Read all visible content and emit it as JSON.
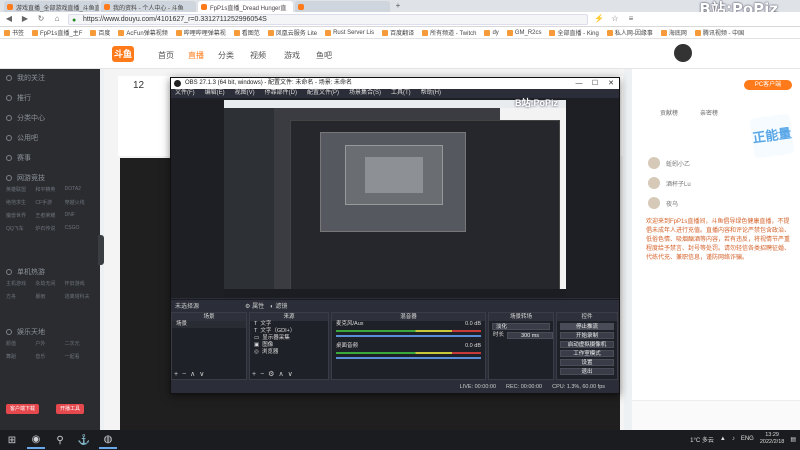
{
  "browser": {
    "tabs": [
      {
        "label": "游戏直播_全部游戏直播_斗鱼直播",
        "active": false
      },
      {
        "label": "我的资料 - 个人中心 - 斗鱼",
        "active": false
      },
      {
        "label": "FpP1s直播_Dread Hunger直",
        "active": true
      },
      {
        "label": "",
        "active": false
      }
    ],
    "tab_add": "+",
    "watermark": "B站:PoPiz",
    "url": "https://www.douyu.com/4101627_r=0.3312711252996054S",
    "bookmarks": [
      "书签",
      "FpP1s直播_主F",
      "百度",
      "AcFun弹幕视频",
      "哔哩哔哩弹幕视",
      "看图范",
      "凤凰云服务 Lite",
      "Rust Server Lis",
      "百度翻译",
      "所有频道 - Twitch",
      "dy",
      "",
      "GM_R2cs",
      "全部直播 - King",
      "",
      "私人网-因缘事",
      "海底网",
      "腾讯视频 - 中国"
    ]
  },
  "site": {
    "logo": "斗鱼",
    "nav": [
      "首页",
      "直播",
      "分类",
      "视频",
      "游戏",
      "鱼吧"
    ],
    "room_number": "12",
    "pc_client": "PC客户端"
  },
  "sidebar": {
    "items": [
      "我的关注",
      "推行",
      "分类中心",
      "公用吧",
      "赛事"
    ],
    "group1_title": "网游竞技",
    "group1": [
      "英雄联盟",
      "和平精英",
      "DOTA2",
      "绝地求生",
      "CF手游",
      "穿越火线",
      "魔兽世界",
      "王者荣耀",
      "DNF",
      "QQ飞车",
      "炉石传说",
      "CSGO"
    ],
    "group2_title": "单机热游",
    "group2": [
      "主机游戏",
      "永劫无间",
      "怀旧游戏",
      "方舟",
      "暴雨",
      "逃离塔科夫"
    ],
    "group3_title": "娱乐天地",
    "group3": [
      "颜值",
      "户外",
      "二次元",
      "舞蹈",
      "音乐",
      "一起看"
    ],
    "bottom_buttons": [
      "客户端下载",
      "开播工具"
    ]
  },
  "chat": {
    "tabs": [
      "贡献榜",
      "亲密榜"
    ],
    "users": [
      "蚯蚓小乙",
      "酒杯子Lu",
      "夜乌"
    ],
    "notice": "欢迎来到FpP1s直播间，斗鱼倡导绿色健康直播，不提倡未成年人进行充值。直播内容和评论严禁包含政治、低俗色情、吸烟酗酒等内容，若有违反，将视情节严重程度给予禁言、封号等处罚。请勿轻信各类招聘征婚、代练代充、兼职信息，谨防网络诈骗。",
    "edu_badge": "正能量",
    "colors": {
      "accent": "#ff7a1a",
      "notice": "#d4622a"
    }
  },
  "obs": {
    "title": "OBS 27.1.3 (64 bit, windows) - 配置文件: 未命名 - 场景: 未命名",
    "menu": [
      "文件(F)",
      "编辑(E)",
      "视图(V)",
      "停靠部件(D)",
      "配置文件(P)",
      "场景集合(S)",
      "工具(T)",
      "帮助(H)"
    ],
    "no_source": "未选择源",
    "props_btn": "属性",
    "filters_btn": "滤镜",
    "preview_wm": "B站:PoPiz",
    "docks": {
      "scenes": {
        "header": "场景",
        "items": [
          "场景"
        ]
      },
      "sources": {
        "header": "来源",
        "items": [
          "文字",
          "文字（GDI+）",
          "显示器采集",
          "图像",
          "浏览器"
        ]
      },
      "mixer": {
        "header": "混音器",
        "ch1": "麦克风/Aux",
        "ch1_db": "0.0 dB",
        "ch2": "桌面音频",
        "ch2_db": "0.0 dB"
      },
      "transitions": {
        "header": "场景转场",
        "mode": "淡化",
        "duration_label": "时长",
        "duration": "300 ms"
      },
      "controls": {
        "header": "控件",
        "buttons": [
          "停止推流",
          "开始录制",
          "启动虚拟摄像机",
          "工作室模式",
          "设置",
          "退出"
        ]
      }
    },
    "status": {
      "live": "LIVE: 00:00:00",
      "rec": "REC: 00:00:00",
      "cpu": "CPU: 1.3%, 60.00 fps"
    }
  },
  "taskbar": {
    "weather": "1°C 多云",
    "lang": "ENG",
    "time": "13:29",
    "date": "2022/2/18"
  }
}
